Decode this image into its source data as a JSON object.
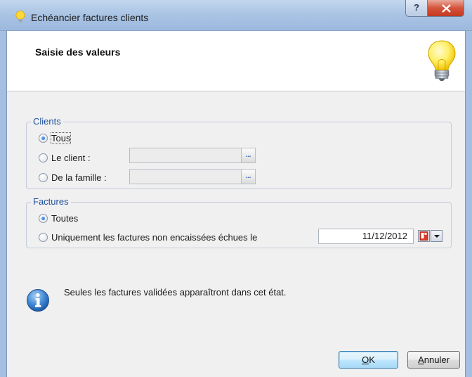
{
  "window": {
    "title": "Echéancier factures clients",
    "help_label": "?"
  },
  "header": {
    "title": "Saisie des valeurs",
    "icon": "lightbulb-icon"
  },
  "clients": {
    "legend": "Clients",
    "options": [
      {
        "label": "Tous",
        "checked": true
      },
      {
        "label": "Le client :",
        "checked": false,
        "value": ""
      },
      {
        "label": "De la famille :",
        "checked": false,
        "value": ""
      }
    ],
    "browse_label": "..."
  },
  "factures": {
    "legend": "Factures",
    "options": [
      {
        "label": "Toutes",
        "checked": true
      },
      {
        "label": "Uniquement les factures non encaissées échues le",
        "checked": false
      }
    ],
    "date": "11/12/2012"
  },
  "info": {
    "icon": "info-icon",
    "text": "Seules les factures validées apparaîtront dans cet état."
  },
  "buttons": {
    "ok_accel": "O",
    "ok_rest": "K",
    "cancel_accel": "A",
    "cancel_rest": "nnuler"
  },
  "colors": {
    "legend": "#1f4f9b",
    "titlebar": "#a9c3e4",
    "close": "#c23a20"
  }
}
